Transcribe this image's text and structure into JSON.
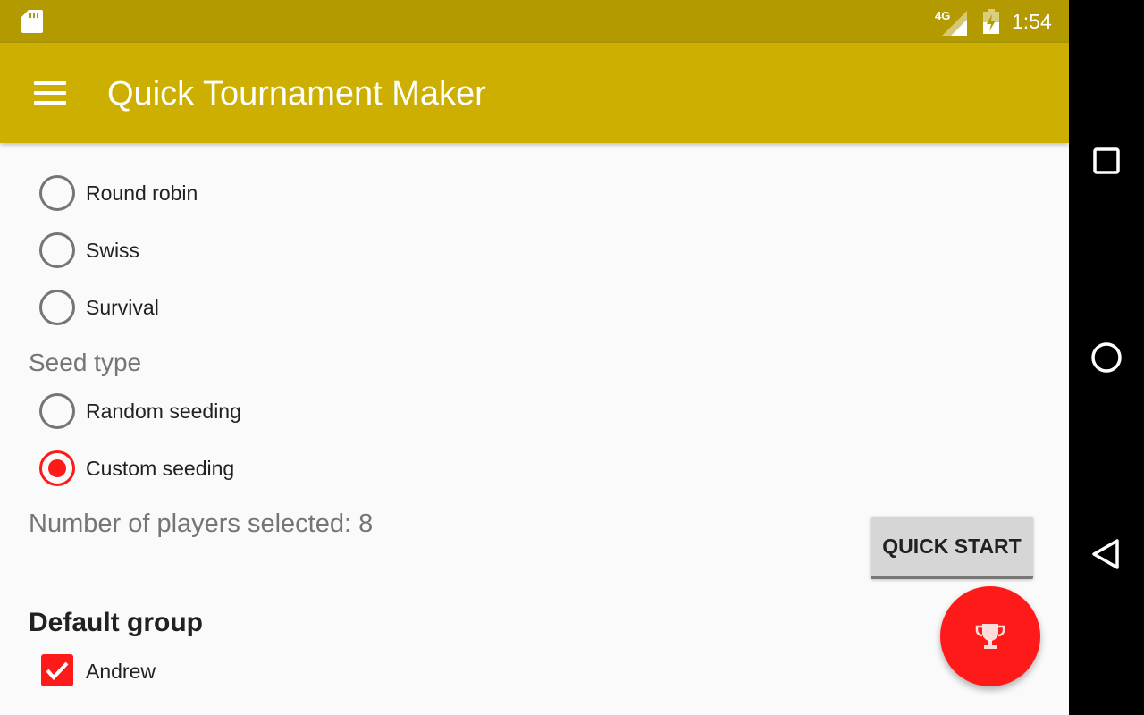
{
  "status_bar": {
    "sd_card_icon": "sd-card-icon",
    "network_label": "4G",
    "battery_icon": "battery-charging-icon",
    "time": "1:54"
  },
  "app_bar": {
    "menu_icon": "hamburger-menu-icon",
    "title": "Quick Tournament Maker"
  },
  "tournament_types": [
    {
      "label": "Round robin",
      "selected": false
    },
    {
      "label": "Swiss",
      "selected": false
    },
    {
      "label": "Survival",
      "selected": false
    }
  ],
  "seed_section": {
    "title": "Seed type",
    "options": [
      {
        "label": "Random seeding",
        "selected": false
      },
      {
        "label": "Custom seeding",
        "selected": true
      }
    ]
  },
  "players_selected_text": "Number of players selected: 8",
  "quick_start_label": "QUICK START",
  "group": {
    "title": "Default group",
    "players": [
      {
        "name": "Andrew",
        "checked": true
      }
    ]
  },
  "fab_icon": "trophy-icon",
  "nav_bar": {
    "recents_icon": "square-recents-icon",
    "home_icon": "circle-home-icon",
    "back_icon": "triangle-back-icon"
  },
  "colors": {
    "status_bar": "#b29a00",
    "app_bar": "#ccaf00",
    "accent": "#ff1a1a",
    "background": "#fafafa"
  }
}
